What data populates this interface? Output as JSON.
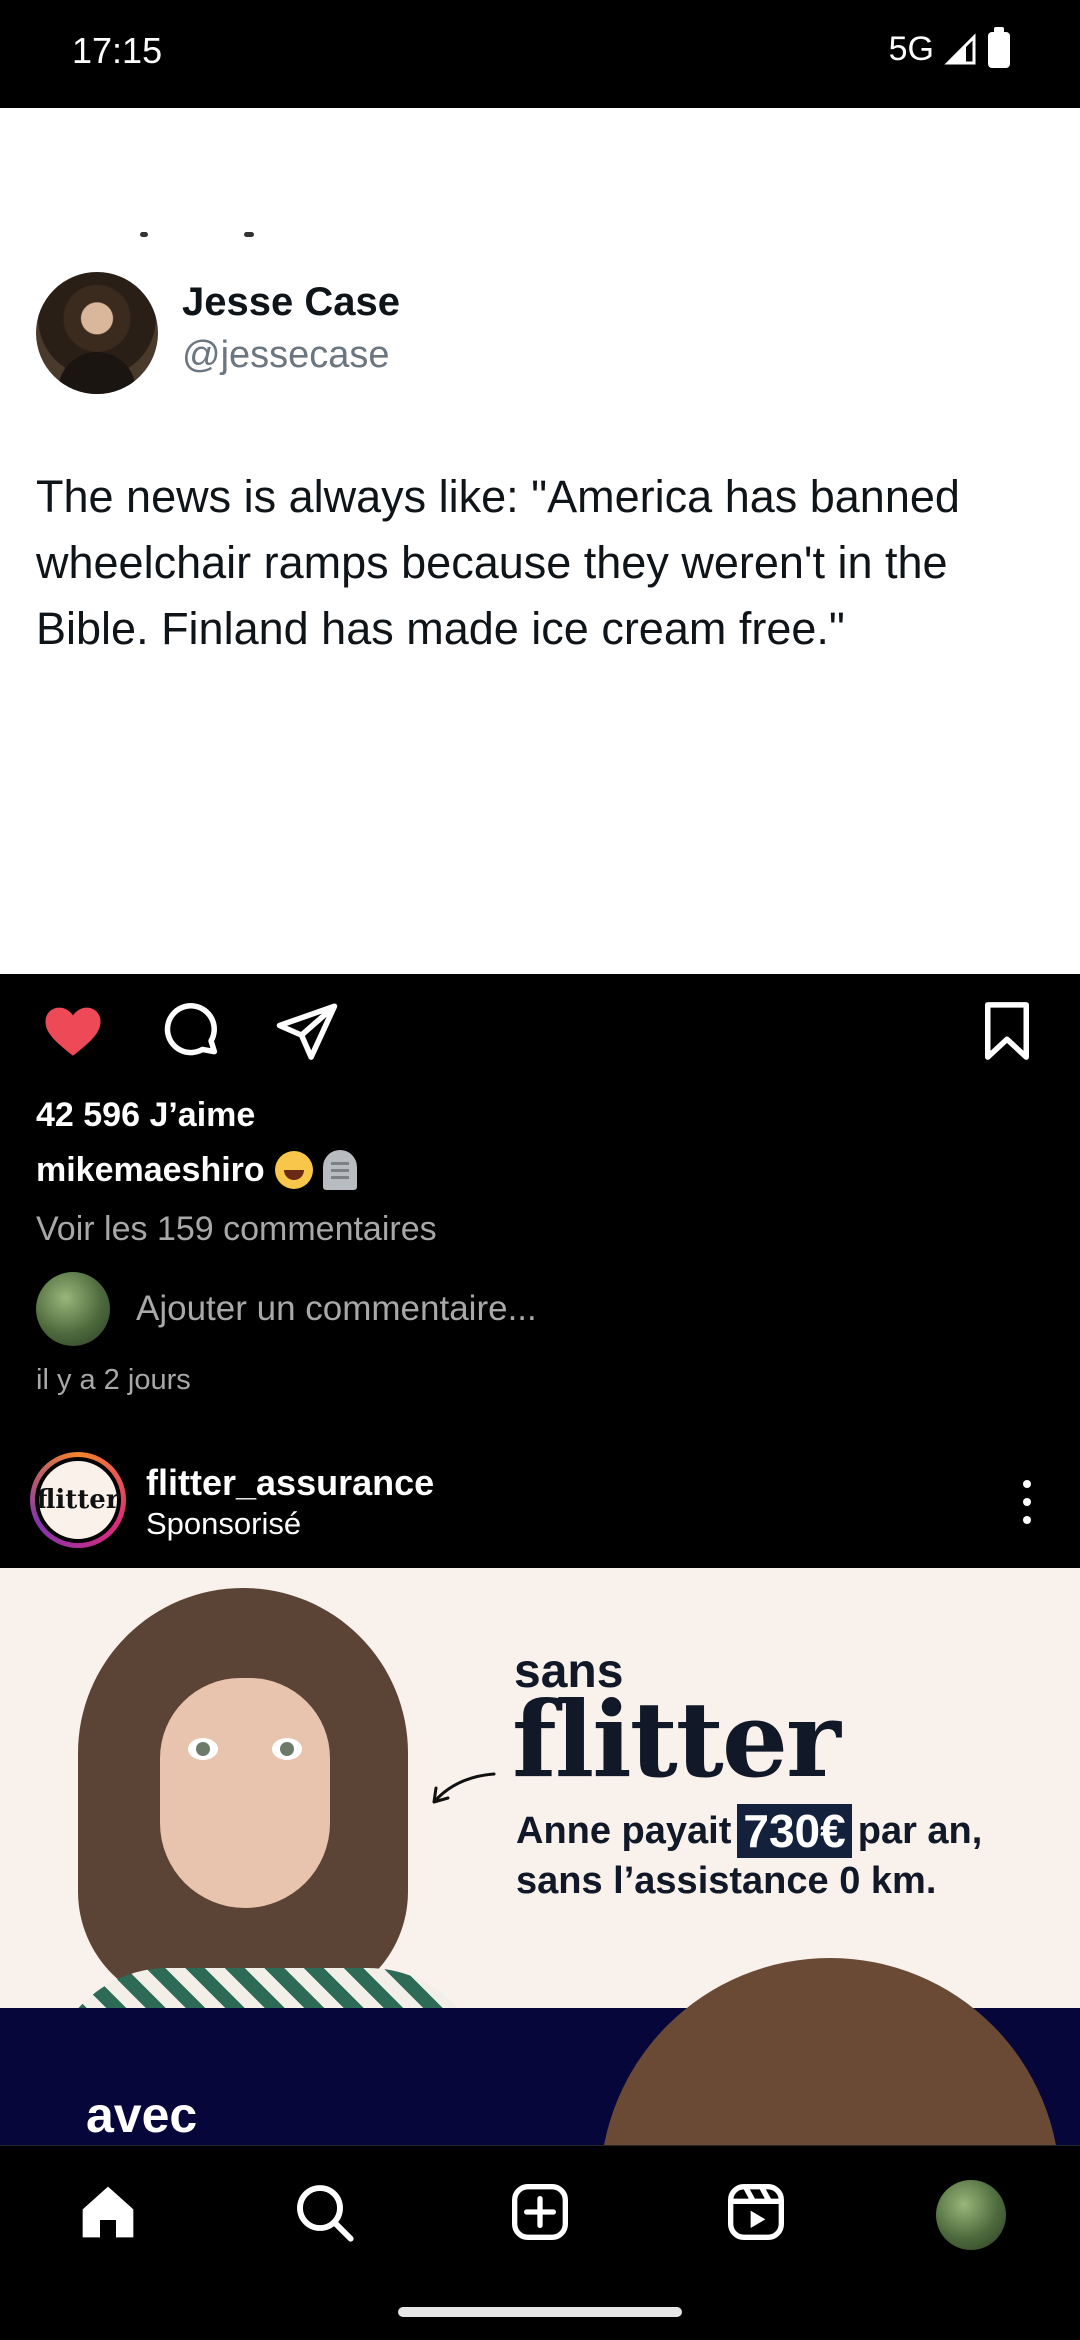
{
  "status_bar": {
    "time": "17:15",
    "network": "5G"
  },
  "tweet": {
    "name": "Jesse Case",
    "handle": "@jessecase",
    "text": "The news is always like: \"America has banned wheelchair ramps because they weren't in the Bible. Finland has made ice cream free.\""
  },
  "post": {
    "liked": true,
    "like_color": "#ed4956",
    "likes": "42 596 J’aime",
    "caption_user": "mikemaeshiro",
    "caption_emojis": [
      "face-with-tears-of-joy",
      "headstone"
    ],
    "view_comments": "Voir les 159 commentaires",
    "add_comment_placeholder": "Ajouter un commentaire...",
    "timestamp": "il y a 2 jours"
  },
  "sponsored": {
    "logo_text": "flitter",
    "account": "flitter_assurance",
    "label": "Sponsorisé"
  },
  "ad": {
    "sans": "sans",
    "brand": "flitter",
    "line1_before": "Anne payait",
    "price": "730€",
    "line1_after": "par an,",
    "line2": "sans l’assistance 0 km.",
    "avec": "avec"
  },
  "bottom_nav": [
    "home-icon",
    "search-icon",
    "create-icon",
    "reels-icon",
    "profile-avatar"
  ]
}
